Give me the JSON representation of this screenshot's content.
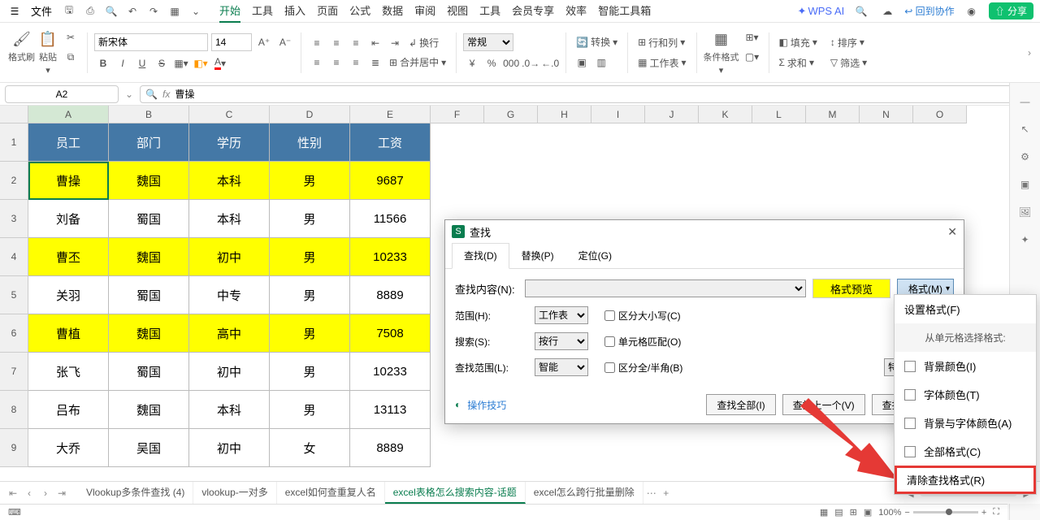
{
  "app": {
    "file_menu": "文件",
    "wps_ai": "WPS AI",
    "back_collab": "回到协作",
    "share": "分享"
  },
  "menu_tabs": [
    "开始",
    "工具",
    "插入",
    "页面",
    "公式",
    "数据",
    "审阅",
    "视图",
    "工具",
    "会员专享",
    "效率",
    "智能工具箱"
  ],
  "active_menu_tab": 0,
  "ribbon": {
    "format_painter": "格式刷",
    "paste": "粘贴",
    "font_name": "新宋体",
    "font_size": "14",
    "wrap": "换行",
    "merge_center": "合并居中",
    "number_format": "常规",
    "convert": "转换",
    "row_col": "行和列",
    "worksheet": "工作表",
    "conditional_format": "条件格式",
    "fill": "填充",
    "sort": "排序",
    "sum": "求和",
    "filter": "筛选"
  },
  "namebox": {
    "cell_ref": "A2",
    "formula_value": "曹操"
  },
  "columns": [
    "A",
    "B",
    "C",
    "D",
    "E",
    "F",
    "G",
    "H",
    "I",
    "J",
    "K",
    "L",
    "M",
    "N",
    "O"
  ],
  "table": {
    "headers": [
      "员工",
      "部门",
      "学历",
      "性别",
      "工资"
    ],
    "rows": [
      {
        "c": [
          "曹操",
          "魏国",
          "本科",
          "男",
          "9687"
        ],
        "hl": true
      },
      {
        "c": [
          "刘备",
          "蜀国",
          "本科",
          "男",
          "11566"
        ],
        "hl": false
      },
      {
        "c": [
          "曹丕",
          "魏国",
          "初中",
          "男",
          "10233"
        ],
        "hl": true
      },
      {
        "c": [
          "关羽",
          "蜀国",
          "中专",
          "男",
          "8889"
        ],
        "hl": false
      },
      {
        "c": [
          "曹植",
          "魏国",
          "高中",
          "男",
          "7508"
        ],
        "hl": true
      },
      {
        "c": [
          "张飞",
          "蜀国",
          "初中",
          "男",
          "10233"
        ],
        "hl": false
      },
      {
        "c": [
          "吕布",
          "魏国",
          "本科",
          "男",
          "13113"
        ],
        "hl": false
      },
      {
        "c": [
          "大乔",
          "吴国",
          "初中",
          "女",
          "8889"
        ],
        "hl": false
      }
    ]
  },
  "dialog": {
    "title": "查找",
    "tabs": [
      "查找(D)",
      "替换(P)",
      "定位(G)"
    ],
    "active_tab": 0,
    "find_label": "查找内容(N):",
    "format_preview": "格式预览",
    "format_btn": "格式(M)",
    "scope_label": "范围(H):",
    "scope_value": "工作表",
    "search_label": "搜索(S):",
    "search_value": "按行",
    "lookin_label": "查找范围(L):",
    "lookin_value": "智能",
    "match_case": "区分大小写(C)",
    "match_cell": "单元格匹配(O)",
    "match_width": "区分全/半角(B)",
    "special": "特殊内容(U)",
    "tip": "操作技巧",
    "find_all": "查找全部(I)",
    "find_prev": "查找上一个(V)",
    "find_next": "查找下一个(F)"
  },
  "format_menu": {
    "set_format": "设置格式(F)",
    "from_cell": "从单元格选择格式:",
    "bg_color": "背景颜色(I)",
    "font_color": "字体颜色(T)",
    "bg_font": "背景与字体颜色(A)",
    "all_format": "全部格式(C)",
    "clear_format": "清除查找格式(R)"
  },
  "sheets": {
    "tabs": [
      "Vlookup多条件查找 (4)",
      "vlookup-一对多",
      "excel如何查重复人名",
      "excel表格怎么搜索内容-话题",
      "excel怎么跨行批量删除"
    ],
    "active": 3
  },
  "status": {
    "zoom": "100%"
  }
}
